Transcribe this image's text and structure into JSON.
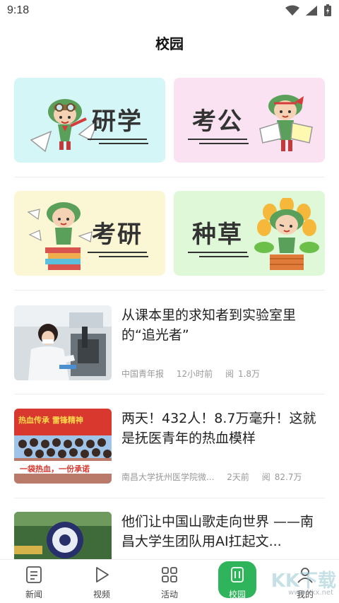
{
  "status_bar": {
    "time": "9:18"
  },
  "page": {
    "title": "校园"
  },
  "categories": [
    {
      "label": "研学",
      "bg": "#d5f6f6"
    },
    {
      "label": "考公",
      "bg": "#fbe2f2"
    },
    {
      "label": "考研",
      "bg": "#fbf6d3"
    },
    {
      "label": "种草",
      "bg": "#def8d8"
    }
  ],
  "news": [
    {
      "title": "从课本里的求知者到实验室里的“追光者”",
      "source": "中国青年报",
      "time": "12小时前",
      "reads_label": "阅",
      "reads": "1.8万"
    },
    {
      "title": "两天！432人！8.7万毫升！这就是抚医青年的热血模样",
      "source": "南昌大学抚州医学院微...",
      "time": "2天前",
      "reads_label": "阅",
      "reads": "82.7万",
      "banner_text": "热血传承 雷锋精神",
      "banner_slogan": "一袋热血，一份承诺"
    },
    {
      "title": "他们让中国山歌走向世界 ——南昌大学生团队用AI扛起文...",
      "source": "",
      "time": "",
      "reads_label": "",
      "reads": ""
    }
  ],
  "tabs": [
    {
      "label": "新闻",
      "icon": "news-icon"
    },
    {
      "label": "视频",
      "icon": "play-icon"
    },
    {
      "label": "活动",
      "icon": "grid-icon"
    },
    {
      "label": "校园",
      "icon": "campus-icon",
      "active": true
    },
    {
      "label": "我的",
      "icon": "user-icon"
    }
  ],
  "watermark": {
    "text": "KK下载",
    "url": "www.kkx.net"
  },
  "colors": {
    "accent": "#2fb35b"
  }
}
